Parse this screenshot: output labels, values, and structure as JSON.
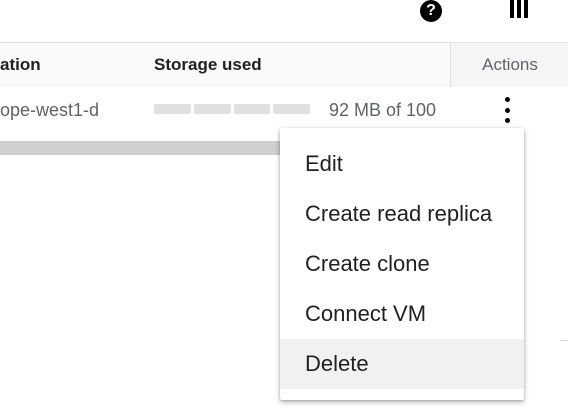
{
  "toolbar": {
    "help_icon": "help-icon",
    "help_glyph": "?",
    "columns_icon": "columns-icon"
  },
  "table": {
    "headers": {
      "location": "ation",
      "storage": "Storage used",
      "actions": "Actions"
    },
    "rows": [
      {
        "location": "ope-west1-d",
        "storage_text": "92 MB of 100",
        "actions_icon": "more-vert-icon"
      }
    ]
  },
  "menu": {
    "items": [
      {
        "label": "Edit"
      },
      {
        "label": "Create read replica"
      },
      {
        "label": "Create clone"
      },
      {
        "label": "Connect VM"
      },
      {
        "label": "Delete"
      }
    ],
    "hovered_item": "Delete"
  },
  "colors": {
    "text": "#202124",
    "muted": "#5f6368",
    "border": "#e0e0e0",
    "hover": "#f1f1f1"
  }
}
